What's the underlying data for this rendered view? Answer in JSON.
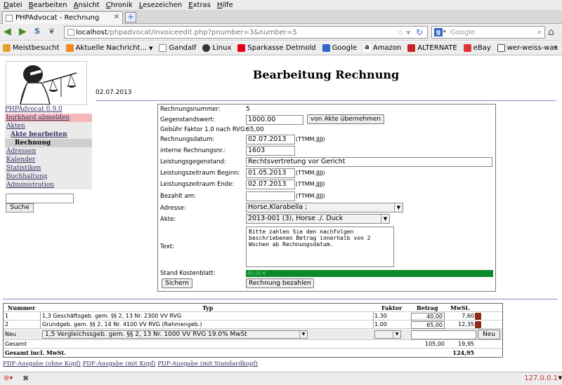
{
  "browser": {
    "menu": [
      "Datei",
      "Bearbeiten",
      "Ansicht",
      "Chronik",
      "Lesezeichen",
      "Extras",
      "Hilfe"
    ],
    "tab_title": "PHPAdvocat - Rechnung",
    "new_tab": "+",
    "url_host": "localhost",
    "url_path": "/phpadvocat/invoiceedit.php?pnumber=3&number=5",
    "search_placeholder": "Google",
    "bookmarks": [
      {
        "label": "Meistbesucht",
        "icon": "folder-icon",
        "color": "#e8a02a"
      },
      {
        "label": "Aktuelle Nachricht...",
        "icon": "rss-icon",
        "color": "#f28a1a"
      },
      {
        "label": "Gandalf",
        "icon": "page-icon",
        "color": "#ffffff"
      },
      {
        "label": "Linux",
        "icon": "linux-icon",
        "color": "#333333"
      },
      {
        "label": "Sparkasse Detmold",
        "icon": "sparkasse-icon",
        "color": "#e2001a"
      },
      {
        "label": "Google",
        "icon": "google-icon",
        "color": "#3366cc"
      },
      {
        "label": "Amazon",
        "icon": "amazon-icon",
        "color": "#222222"
      },
      {
        "label": "ALTERNATE",
        "icon": "alternate-icon",
        "color": "#cc2222"
      },
      {
        "label": "eBay",
        "icon": "ebay-icon",
        "color": "#e53238"
      },
      {
        "label": "wer-weiss-was",
        "icon": "www-icon",
        "color": "#444444"
      }
    ],
    "status_right": "127.0.0.1"
  },
  "app": {
    "title": "Bearbeitung Rechnung",
    "date": "02.07.2013",
    "sidebar": {
      "version": "PHPAdvocat 0.9.0",
      "logout": "burkhard abmelden",
      "items": [
        "Akten",
        "Akte bearbeiten",
        "Rechnung",
        "Adressen",
        "Kalender",
        "Statistiken",
        "Buchhaltung",
        "Administration"
      ],
      "search_value": "",
      "search_button": "Suche"
    },
    "form": {
      "rechnungsnummer_label": "Rechnungsnummer:",
      "rechnungsnummer": "5",
      "gegenstandswert_label": "Gegenstandswert:",
      "gegenstandswert": "1000.00",
      "von_akte_button": "von Akte übernehmen",
      "gebuehr_label": "Gebühr Faktor 1.0 nach RVG:",
      "gebuehr": "65,00",
      "rechnungsdatum_label": "Rechnungsdatum:",
      "rechnungsdatum": "02.07.2013",
      "date_hint": "(TTMM.JJJJ)",
      "interne_label": "interne Rechnungsnr.:",
      "interne": "1603",
      "leistungsgegenstand_label": "Leistungsgegenstand:",
      "leistungsgegenstand": "Rechtsvertretung vor Gericht",
      "beginn_label": "Leistungszeitraum Beginn:",
      "beginn": "01.05.2013",
      "ende_label": "Leistungszeitraum Ende:",
      "ende": "02.07.2013",
      "bezahlt_label": "Bezahlt am:",
      "bezahlt": "",
      "adresse_label": "Adresse:",
      "adresse": "Horse,Klarabella ;",
      "akte_label": "Akte:",
      "akte": "2013-001 (3), Horse ./. Duck",
      "text_label": "Text:",
      "text": "Bitte zahlen Sie den nachfolgen\nbeschriebenen Betrag innerhalb von 2\nWochen ab Rechnungsdatum.",
      "kostenblatt_label": "Stand Kostenblatt:",
      "kostenblatt": "80,00 €",
      "sichern_button": "Sichern",
      "bezahlen_button": "Rechnung bezahlen"
    },
    "table": {
      "headers": [
        "Nummer",
        "Typ",
        "Faktor",
        "Betrag",
        "MwSt."
      ],
      "rows": [
        {
          "nummer": "1",
          "typ": "1,3 Geschäftsgeb. gem. §§ 2, 13 Nr. 2300 VV RVG",
          "faktor": "1.30",
          "betrag": "40,00",
          "mwst": "7,60"
        },
        {
          "nummer": "2",
          "typ": "Grundgeb. gem. §§ 2, 14 Nr. 4100 VV RVG (Rahmengeb.)",
          "faktor": "1.00",
          "betrag": "65,00",
          "mwst": "12,35"
        }
      ],
      "new_label": "Neu",
      "new_typ": "1,5 Vergleichssgeb. gem. §§ 2, 13 Nr. 1000 VV RVG 19.0% MwSt",
      "new_faktor": "",
      "new_betrag": "",
      "new_button": "Neu",
      "gesamt_label": "Gesamt",
      "gesamt_betrag": "105,00",
      "gesamt_mwst": "19,95",
      "gesamt_incl_label": "Gesamt incl. MwSt.",
      "gesamt_incl": "124,95"
    },
    "links": [
      "PDF-Ausgabe (ohne Kopf)",
      "PDF-Ausgabe (mit Kopf)",
      "PDF-Ausgabe (mit Standardkopf)"
    ]
  }
}
